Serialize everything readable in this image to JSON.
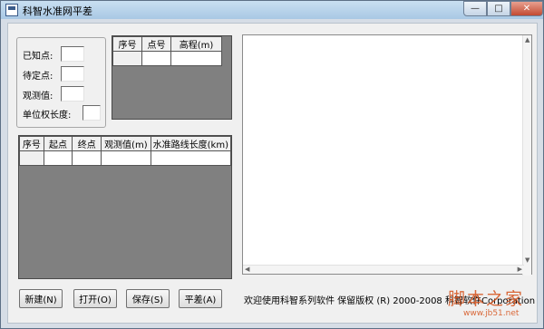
{
  "window": {
    "title": "科智水准网平差",
    "controls": {
      "minimize": "—",
      "maximize": "□",
      "close": "✕"
    }
  },
  "info_panel": {
    "known_label": "已知点:",
    "known_value": "",
    "pending_label": "待定点:",
    "pending_value": "",
    "observed_label": "观测值:",
    "observed_value": "",
    "unit_weight_label": "单位权长度:",
    "unit_weight_value": ""
  },
  "known_points_grid": {
    "headers": [
      "序号",
      "点号",
      "高程(m)"
    ]
  },
  "observations_grid": {
    "headers": [
      "序号",
      "起点",
      "终点",
      "观测值(m)",
      "水准路线长度(km)"
    ]
  },
  "buttons": {
    "new": "新建(N)",
    "open": "打开(O)",
    "save": "保存(S)",
    "adjust": "平差(A)"
  },
  "status_text": "欢迎使用科智系列软件  保留版权  (R) 2000-2008 科智软件Corporation",
  "watermark": {
    "main": "脚本之家",
    "url": "www.jb51.net"
  },
  "colors": {
    "grid_background": "#808080",
    "window_background": "#f0f0f0",
    "watermark": "#d5511a"
  }
}
